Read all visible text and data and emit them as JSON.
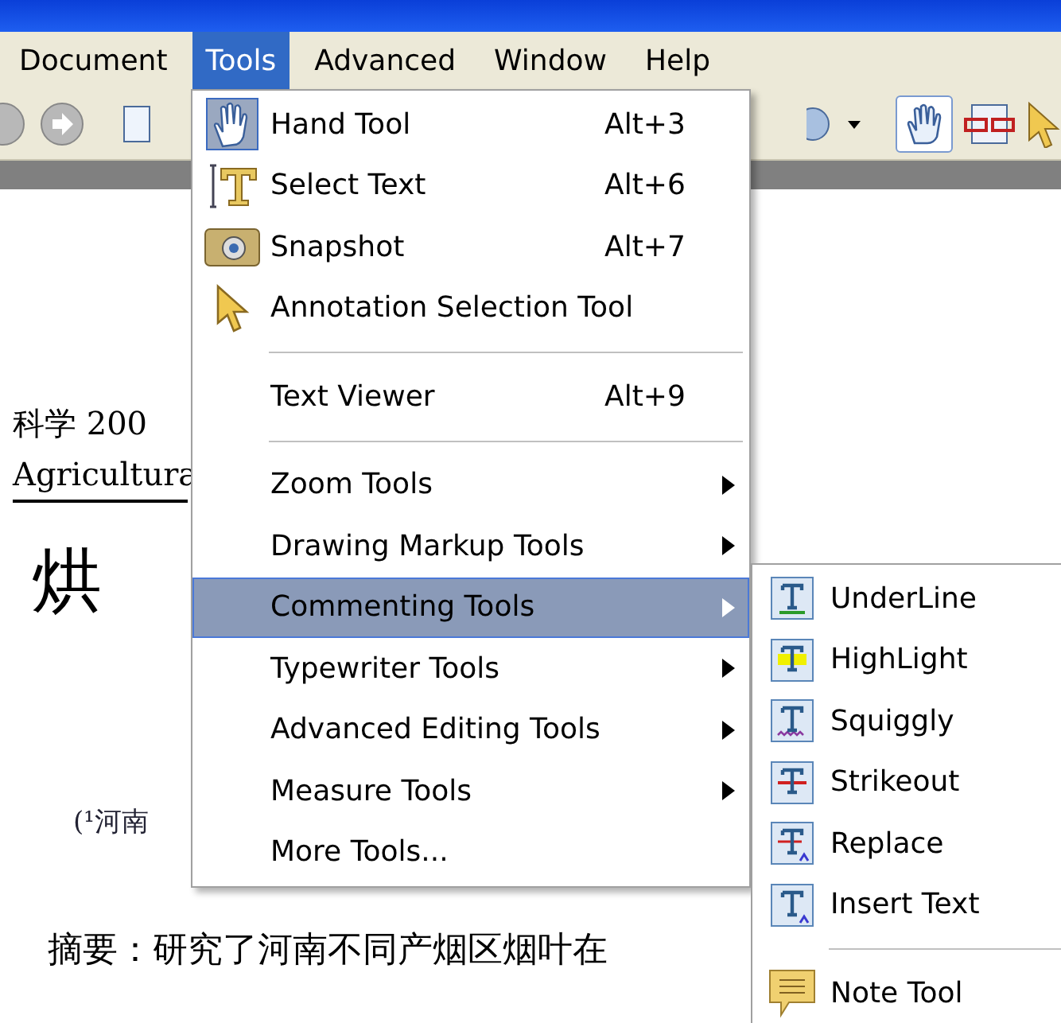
{
  "menubar": [
    {
      "label": "Document",
      "selected": false
    },
    {
      "label": "Tools",
      "selected": true
    },
    {
      "label": "Advanced",
      "selected": false
    },
    {
      "label": "Window",
      "selected": false
    },
    {
      "label": "Help",
      "selected": false
    }
  ],
  "toolbar": {
    "hand_tool_selected": true
  },
  "document": {
    "lines": [
      {
        "kind": "small",
        "text": "科学 200"
      },
      {
        "kind": "latin",
        "text": "Agricultura"
      },
      {
        "kind": "title",
        "text": "烘"
      },
      {
        "kind": "affil",
        "text": "(¹河南"
      },
      {
        "kind": "abstract",
        "text": "摘要：研究了河南不同产烟区烟叶在"
      }
    ]
  },
  "tools_menu": {
    "items": [
      {
        "kind": "hand",
        "label": "Hand Tool",
        "shortcut": "Alt+3",
        "selected": false,
        "submenu": false
      },
      {
        "kind": "text",
        "label": "Select Text",
        "shortcut": "Alt+6",
        "selected": false,
        "submenu": false
      },
      {
        "kind": "camera",
        "label": "Snapshot",
        "shortcut": "Alt+7",
        "selected": false,
        "submenu": false
      },
      {
        "kind": "cursor",
        "label": "Annotation Selection Tool",
        "selected": false,
        "submenu": false
      },
      {
        "kind": "separator"
      },
      {
        "kind": "plain",
        "label": "Text Viewer",
        "shortcut": "Alt+9",
        "selected": false,
        "submenu": false
      },
      {
        "kind": "separator"
      },
      {
        "kind": "plain",
        "label": "Zoom Tools",
        "selected": false,
        "submenu": true
      },
      {
        "kind": "plain",
        "label": "Drawing Markup Tools",
        "selected": false,
        "submenu": true
      },
      {
        "kind": "plain",
        "label": "Commenting Tools",
        "selected": true,
        "submenu": true
      },
      {
        "kind": "plain",
        "label": "Typewriter Tools",
        "selected": false,
        "submenu": true
      },
      {
        "kind": "plain",
        "label": "Advanced Editing Tools",
        "selected": false,
        "submenu": true
      },
      {
        "kind": "plain",
        "label": "Measure Tools",
        "selected": false,
        "submenu": true
      },
      {
        "kind": "plain",
        "label": "More Tools...",
        "selected": false,
        "submenu": false
      }
    ]
  },
  "commenting_submenu": {
    "items": [
      {
        "kind": "underline",
        "label": "UnderLine"
      },
      {
        "kind": "highlight",
        "label": "HighLight"
      },
      {
        "kind": "squiggly",
        "label": "Squiggly"
      },
      {
        "kind": "strikeout",
        "label": "Strikeout"
      },
      {
        "kind": "replace",
        "label": "Replace"
      },
      {
        "kind": "insert",
        "label": "Insert Text"
      },
      {
        "kind": "separator"
      },
      {
        "kind": "note",
        "label": "Note Tool"
      }
    ]
  }
}
